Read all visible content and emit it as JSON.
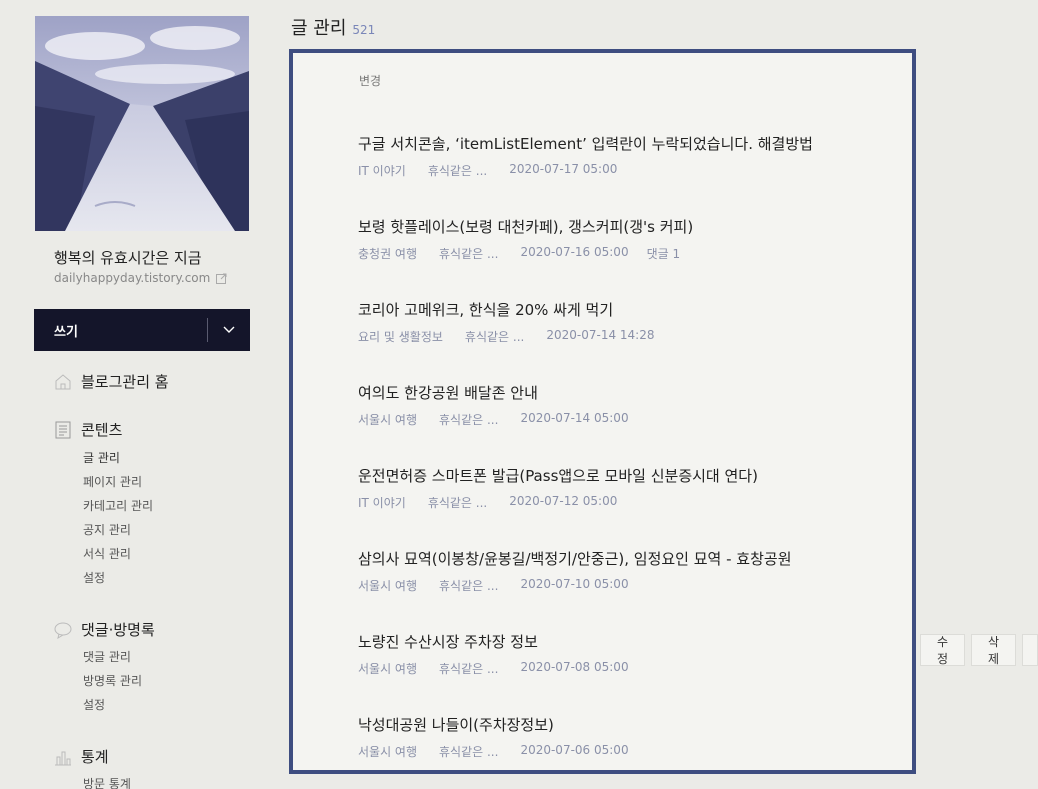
{
  "sidebar": {
    "blog_title": "행복의 유효시간은 지금",
    "blog_url": "dailyhappyday.tistory.com",
    "write_label": "쓰기",
    "home_label": "블로그관리 홈",
    "contents": {
      "label": "콘텐츠",
      "items": [
        "글 관리",
        "페이지 관리",
        "카테고리 관리",
        "공지 관리",
        "서식 관리",
        "설정"
      ]
    },
    "comments": {
      "label": "댓글·방명록",
      "items": [
        "댓글 관리",
        "방명록 관리",
        "설정"
      ]
    },
    "stats": {
      "label": "통계",
      "items": [
        "방문 통계"
      ]
    }
  },
  "main": {
    "title": "글 관리",
    "count": "521",
    "change_label": "변경",
    "posts": [
      {
        "title": "구글 서치콘솔, ‘itemListElement’ 입력란이 누락되었습니다. 해결방법",
        "category": "IT 이야기",
        "author": "휴식같은 ...",
        "date": "2020-07-17 05:00",
        "comments": ""
      },
      {
        "title": "보령 핫플레이스(보령 대천카페), 갱스커피(갱's 커피)",
        "category": "충청권 여행",
        "author": "휴식같은 ...",
        "date": "2020-07-16 05:00",
        "comments": "댓글 1"
      },
      {
        "title": "코리아 고메위크, 한식을 20% 싸게 먹기",
        "category": "요리 및 생활정보",
        "author": "휴식같은 ...",
        "date": "2020-07-14 14:28",
        "comments": ""
      },
      {
        "title": "여의도 한강공원 배달존 안내",
        "category": "서울시 여행",
        "author": "휴식같은 ...",
        "date": "2020-07-14 05:00",
        "comments": ""
      },
      {
        "title": "운전면허증 스마트폰 발급(Pass앱으로 모바일 신분증시대 연다)",
        "category": "IT 이야기",
        "author": "휴식같은 ...",
        "date": "2020-07-12 05:00",
        "comments": ""
      },
      {
        "title": "삼의사 묘역(이봉창/윤봉길/백정기/안중근), 임정요인 묘역 - 효창공원",
        "category": "서울시 여행",
        "author": "휴식같은 ...",
        "date": "2020-07-10 05:00",
        "comments": ""
      },
      {
        "title": "노량진 수산시장 주차장 정보",
        "category": "서울시 여행",
        "author": "휴식같은 ...",
        "date": "2020-07-08 05:00",
        "comments": ""
      },
      {
        "title": "낙성대공원 나들이(주차장정보)",
        "category": "서울시 여행",
        "author": "휴식같은 ...",
        "date": "2020-07-06 05:00",
        "comments": ""
      }
    ],
    "actions": {
      "edit": "수정",
      "delete": "삭제"
    }
  },
  "icons": {
    "external": "external-link-icon",
    "dropdown": "chevron-down-icon",
    "home": "home-icon",
    "contents": "document-icon",
    "comments": "speech-bubble-icon",
    "stats": "bar-chart-icon"
  },
  "colors": {
    "accent_border": "#3e4d80",
    "write_button": "#14152a",
    "count": "#7a86b8"
  }
}
